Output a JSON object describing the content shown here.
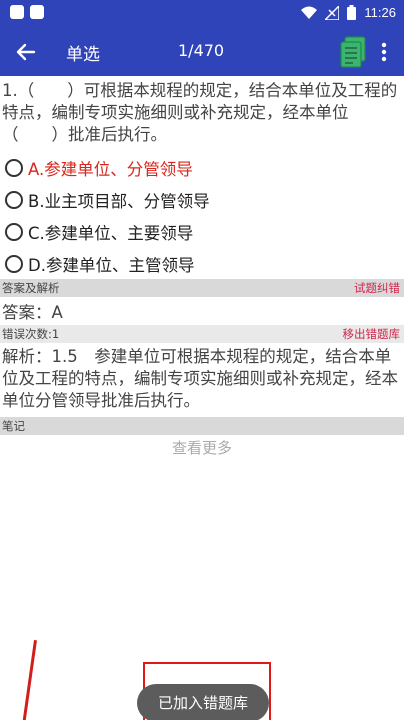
{
  "status_bar": {
    "time": "11:26"
  },
  "app_bar": {
    "title": "单选",
    "counter": "1/470"
  },
  "question": {
    "text": "1.（　　）可根据本规程的规定，结合本单位及工程的特点，编制专项实施细则或补充规定，经本单位（　　）批准后执行。"
  },
  "options": [
    {
      "label": "A.参建单位、分管领导",
      "selected": true
    },
    {
      "label": "B.业主项目部、分管领导",
      "selected": false
    },
    {
      "label": "C.参建单位、主要领导",
      "selected": false
    },
    {
      "label": "D.参建单位、主管领导",
      "selected": false
    }
  ],
  "answer_section": {
    "header": "答案及解析",
    "action": "试题纠错",
    "answer": "答案：A"
  },
  "error_section": {
    "header": "错误次数:1",
    "action": "移出错题库"
  },
  "analysis": "解析：1.5　参建单位可根据本规程的规定，结合本单位及工程的特点，编制专项实施细则或补充规定，经本单位分管领导批准后执行。",
  "notes_section": {
    "header": "笔记",
    "see_more": "查看更多"
  },
  "toast": "已加入错题库",
  "colors": {
    "primary": "#2f44b8",
    "selected_option": "#d9261c",
    "action_link": "#d0254a",
    "icon_green": "#3cb371"
  }
}
